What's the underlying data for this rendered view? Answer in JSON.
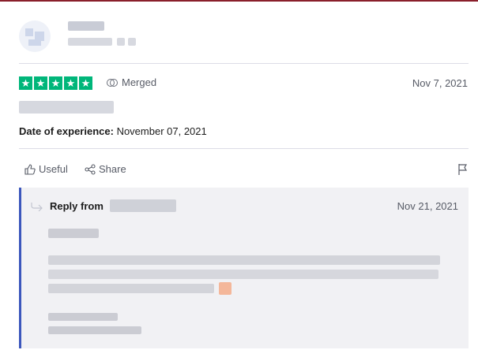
{
  "review": {
    "rating_stars": [
      "★",
      "★",
      "★",
      "★",
      "★"
    ],
    "rating_value": 5,
    "merged_label": "Merged",
    "date": "Nov 7, 2021",
    "experience_label": "Date of experience:",
    "experience_date": "November 07, 2021"
  },
  "actions": {
    "useful_label": "Useful",
    "share_label": "Share"
  },
  "reply": {
    "title_prefix": "Reply from",
    "date": "Nov 21, 2021"
  },
  "colors": {
    "star_green": "#00b67a",
    "reply_accent": "#3c57bc",
    "reply_bg": "#f1f1f4",
    "muted_text": "#575b66"
  }
}
